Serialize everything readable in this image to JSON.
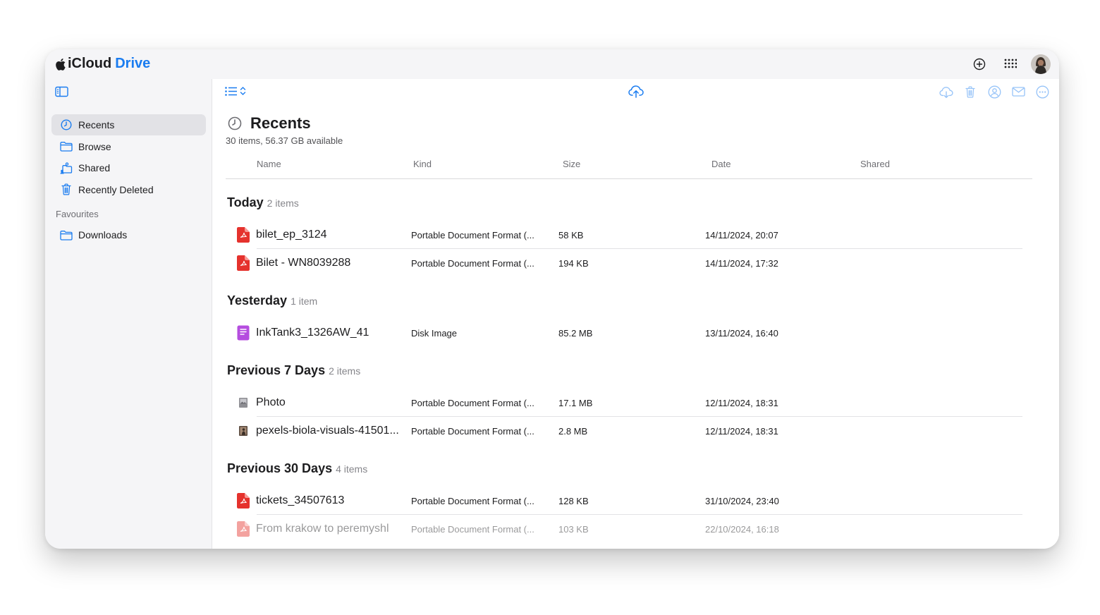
{
  "app": {
    "brand_prefix": "iCloud",
    "brand_suffix": "Drive"
  },
  "colors": {
    "accent": "#1a7cf0",
    "pdf_red": "#e5322d",
    "disk_purple": "#b54ddf"
  },
  "titlebar": {
    "icons": [
      "add-circle-icon",
      "app-grid-icon",
      "user-avatar"
    ]
  },
  "sidebar": {
    "items": [
      {
        "label": "Recents",
        "icon": "clock-icon",
        "active": true
      },
      {
        "label": "Browse",
        "icon": "folder-icon",
        "active": false
      },
      {
        "label": "Shared",
        "icon": "shared-folder-icon",
        "active": false
      },
      {
        "label": "Recently Deleted",
        "icon": "trash-icon",
        "active": false
      }
    ],
    "favourites_header": "Favourites",
    "favourites": [
      {
        "label": "Downloads",
        "icon": "folder-icon"
      }
    ]
  },
  "toolbar": {
    "icons": [
      "list-view-icon",
      "sort-chevron-icon",
      "upload-cloud-icon",
      "download-cloud-icon",
      "trash-icon",
      "share-person-icon",
      "mail-icon",
      "more-icon"
    ]
  },
  "page": {
    "title": "Recents",
    "subtitle": "30 items, 56.37 GB available"
  },
  "columns": {
    "name": "Name",
    "kind": "Kind",
    "size": "Size",
    "date": "Date",
    "shared": "Shared"
  },
  "groups": [
    {
      "title": "Today",
      "count": "2 items",
      "rows": [
        {
          "name": "bilet_ep_3124",
          "kind": "Portable Document Format (...",
          "size": "58 KB",
          "date": "14/11/2024, 20:07",
          "icon": "pdf-icon"
        },
        {
          "name": "Bilet - WN8039288",
          "kind": "Portable Document Format (...",
          "size": "194 KB",
          "date": "14/11/2024, 17:32",
          "icon": "pdf-icon"
        }
      ]
    },
    {
      "title": "Yesterday",
      "count": "1 item",
      "rows": [
        {
          "name": "InkTank3_1326AW_41",
          "kind": "Disk Image",
          "size": "85.2 MB",
          "date": "13/11/2024, 16:40",
          "icon": "disk-image-icon"
        }
      ]
    },
    {
      "title": "Previous 7 Days",
      "count": "2 items",
      "rows": [
        {
          "name": "Photo",
          "kind": "Portable Document Format (...",
          "size": "17.1 MB",
          "date": "12/11/2024, 18:31",
          "icon": "photo-thumbnail-icon"
        },
        {
          "name": "pexels-biola-visuals-41501...",
          "kind": "Portable Document Format (...",
          "size": "2.8 MB",
          "date": "12/11/2024, 18:31",
          "icon": "photo-thumbnail-icon"
        }
      ]
    },
    {
      "title": "Previous 30 Days",
      "count": "4 items",
      "rows": [
        {
          "name": "tickets_34507613",
          "kind": "Portable Document Format (...",
          "size": "128 KB",
          "date": "31/10/2024, 23:40",
          "icon": "pdf-icon"
        },
        {
          "name": "From krakow to peremyshl",
          "kind": "Portable Document Format (...",
          "size": "103 KB",
          "date": "22/10/2024, 16:18",
          "icon": "pdf-icon"
        }
      ]
    }
  ]
}
